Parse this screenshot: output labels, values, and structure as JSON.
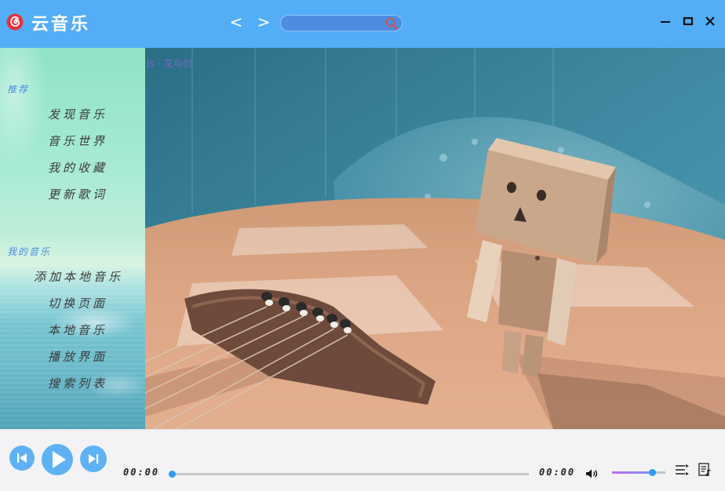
{
  "app": {
    "title": "云音乐",
    "accent_color": "#54adf7",
    "icons": {
      "logo": "netease-music-logo-icon"
    }
  },
  "titlebar": {
    "back_label": "<",
    "forward_label": ">",
    "search": {
      "value": "",
      "placeholder": "",
      "icon": "search-icon"
    },
    "window_controls": [
      "minimize-icon",
      "maximize-icon",
      "close-icon"
    ]
  },
  "sidebar": {
    "sections": [
      {
        "label": "推荐",
        "items": [
          {
            "label": "发现音乐"
          },
          {
            "label": "音乐世界"
          },
          {
            "label": "我的收藏"
          },
          {
            "label": "更新歌词"
          }
        ]
      },
      {
        "label": "我的音乐",
        "items": [
          {
            "label": "添加本地音乐"
          },
          {
            "label": "切换页面"
          },
          {
            "label": "本地音乐"
          },
          {
            "label": "播放界面"
          },
          {
            "label": "搜索列表"
          }
        ]
      }
    ]
  },
  "main": {
    "now_playing": "Js - 花与剑"
  },
  "player": {
    "current_time": "00:00",
    "total_time": "00:00",
    "progress": 0,
    "volume": 0.75,
    "icons": [
      "previous-icon",
      "play-icon",
      "next-icon",
      "volume-icon",
      "playlist-icon",
      "lyrics-icon"
    ]
  }
}
